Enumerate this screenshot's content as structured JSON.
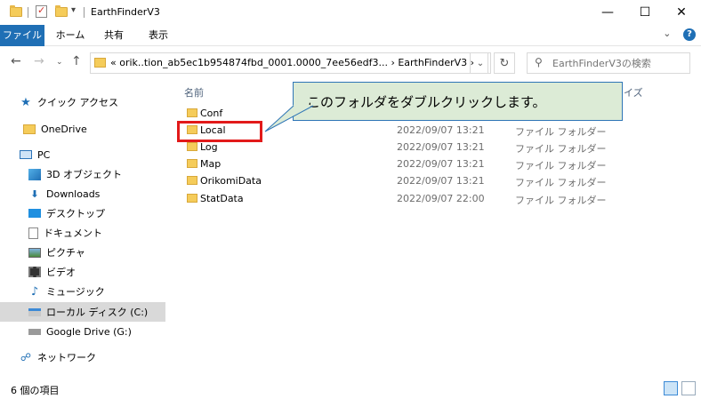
{
  "window": {
    "title": "EarthFinderV3",
    "minimize": "—",
    "maximize": "☐",
    "close": "✕"
  },
  "ribbon": {
    "tabs": [
      "ファイル",
      "ホーム",
      "共有",
      "表示"
    ]
  },
  "address": {
    "path": "« orik..tion_ab5ec1b954874fbd_0001.0000_7ee56edf3... › EarthFinderV3 ›",
    "search_placeholder": "EarthFinderV3の検索"
  },
  "nav": {
    "items": [
      {
        "label": "クイック アクセス",
        "icon": "star-icon"
      },
      {
        "label": "OneDrive",
        "icon": "folder-icon"
      },
      {
        "label": "PC",
        "icon": "pc-icon"
      },
      {
        "label": "3D オブジェクト",
        "icon": "cube-icon"
      },
      {
        "label": "Downloads",
        "icon": "download-icon"
      },
      {
        "label": "デスクトップ",
        "icon": "desktop-icon"
      },
      {
        "label": "ドキュメント",
        "icon": "document-icon"
      },
      {
        "label": "ピクチャ",
        "icon": "picture-icon"
      },
      {
        "label": "ビデオ",
        "icon": "video-icon"
      },
      {
        "label": "ミュージック",
        "icon": "music-icon"
      },
      {
        "label": "ローカル ディスク (C:)",
        "icon": "disk-icon"
      },
      {
        "label": "Google Drive (G:)",
        "icon": "drive-icon"
      },
      {
        "label": "ネットワーク",
        "icon": "network-icon"
      }
    ]
  },
  "columns": {
    "name": "名前",
    "size": "イズ"
  },
  "files": [
    {
      "name": "Conf",
      "date": "",
      "type": ""
    },
    {
      "name": "Local",
      "date": "2022/09/07 13:21",
      "type": "ファイル フォルダー"
    },
    {
      "name": "Log",
      "date": "2022/09/07 13:21",
      "type": "ファイル フォルダー"
    },
    {
      "name": "Map",
      "date": "2022/09/07 13:21",
      "type": "ファイル フォルダー"
    },
    {
      "name": "OrikomiData",
      "date": "2022/09/07 13:21",
      "type": "ファイル フォルダー"
    },
    {
      "name": "StatData",
      "date": "2022/09/07 22:00",
      "type": "ファイル フォルダー"
    }
  ],
  "callout": {
    "text": "このフォルダをダブルクリックします。"
  },
  "status": {
    "count": "6 個の項目"
  },
  "colors": {
    "accent": "#1f6fb5",
    "highlight": "#e21a1a",
    "callout_bg": "#dcebd6"
  }
}
